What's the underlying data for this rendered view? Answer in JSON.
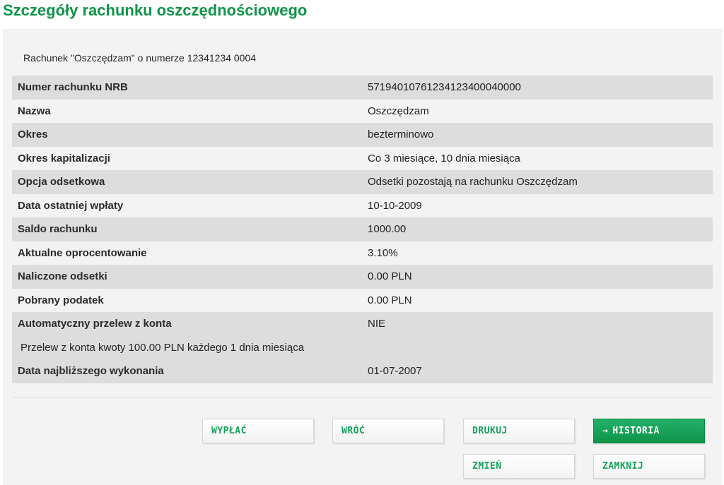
{
  "header": {
    "title": "Szczegóły rachunku oszczędnościowego"
  },
  "account": {
    "info": "Rachunek \"Oszczędzam\" o numerze 12341234 0004"
  },
  "details": {
    "rows": [
      {
        "label": "Numer rachunku NRB",
        "value": "57194010761234123400040000"
      },
      {
        "label": "Nazwa",
        "value": "Oszczędzam"
      },
      {
        "label": "Okres",
        "value": "bezterminowo"
      },
      {
        "label": "Okres kapitalizacji",
        "value": "Co 3 miesiące, 10 dnia miesiąca"
      },
      {
        "label": "Opcja odsetkowa",
        "value": "Odsetki pozostają na rachunku Oszczędzam"
      },
      {
        "label": "Data ostatniej wpłaty",
        "value": "10-10-2009"
      },
      {
        "label": "Saldo rachunku",
        "value": "1000.00"
      },
      {
        "label": "Aktualne oprocentowanie",
        "value": "3.10%"
      },
      {
        "label": "Naliczone odsetki",
        "value": "0.00  PLN"
      },
      {
        "label": "Pobrany podatek",
        "value": "0.00  PLN"
      },
      {
        "label": "Automatyczny przelew z konta",
        "value": "NIE"
      },
      {
        "note": "Przelew z konta kwoty 100.00 PLN każdego 1 dnia miesiąca"
      },
      {
        "label": "Data najbliższego wykonania",
        "value": "01-07-2007"
      }
    ]
  },
  "buttons": {
    "withdraw": "WYPŁAĆ",
    "back": "WRÓĆ",
    "print": "DRUKUJ",
    "history": "HISTORIA",
    "history_arrow": "→",
    "change": "ZMIEŃ",
    "close": "ZAMKNIJ"
  },
  "colors": {
    "accent": "#0f9448",
    "row_shade": "#dddddd",
    "panel_bg": "#f3f3f3"
  }
}
